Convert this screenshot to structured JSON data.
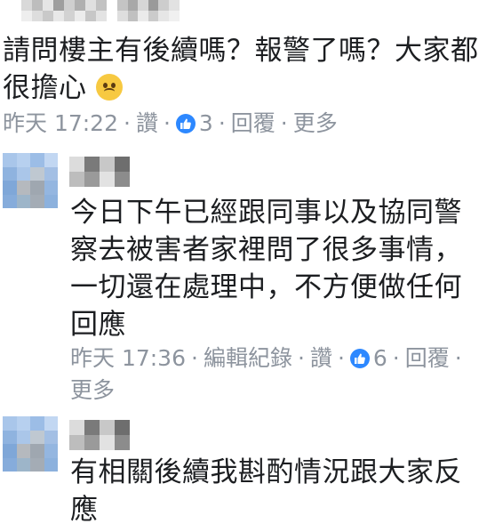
{
  "comment1": {
    "text": "請問樓主有後續嗎？報警了嗎？大家都\n很擔心",
    "emoji": "worried-face",
    "time": "昨天 17:22",
    "like_label": "讚",
    "like_count": "3",
    "reply_label": "回覆",
    "more_label": "更多"
  },
  "reply1": {
    "text": "今日下午已經跟同事以及協同警\n察去被害者家裡問了很多事情，\n一切還在處理中，不方便做任何\n回應",
    "time": "昨天 17:36",
    "edit_history_label": "編輯紀錄",
    "like_label": "讚",
    "like_count": "6",
    "reply_label": "回覆",
    "more_label": "更多"
  },
  "reply2": {
    "text": "有相關後續我斟酌情況跟大家反\n應"
  },
  "colors": {
    "meta": "#8d949e",
    "like_blue": "#2d88ff",
    "text": "#1c1e21"
  }
}
